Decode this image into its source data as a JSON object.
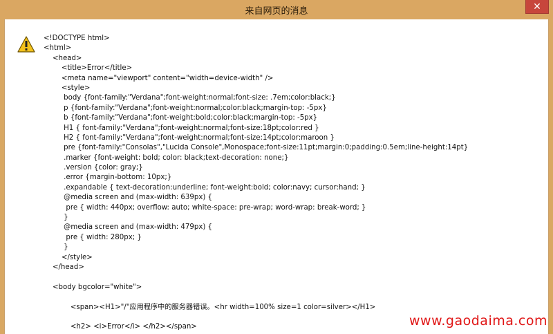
{
  "window": {
    "title": "来自网页的消息",
    "close_glyph": "✕"
  },
  "dialog": {
    "icon": "warning-icon",
    "lines": [
      "<!DOCTYPE html>",
      "<html>",
      "    <head>",
      "        <title>Error</title>",
      "        <meta name=\"viewport\" content=\"width=device-width\" />",
      "        <style>",
      "         body {font-family:\"Verdana\";font-weight:normal;font-size: .7em;color:black;}",
      "         p {font-family:\"Verdana\";font-weight:normal;color:black;margin-top: -5px}",
      "         b {font-family:\"Verdana\";font-weight:bold;color:black;margin-top: -5px}",
      "         H1 { font-family:\"Verdana\";font-weight:normal;font-size:18pt;color:red }",
      "         H2 { font-family:\"Verdana\";font-weight:normal;font-size:14pt;color:maroon }",
      "         pre {font-family:\"Consolas\",\"Lucida Console\",Monospace;font-size:11pt;margin:0;padding:0.5em;line-height:14pt}",
      "         .marker {font-weight: bold; color: black;text-decoration: none;}",
      "         .version {color: gray;}",
      "         .error {margin-bottom: 10px;}",
      "         .expandable { text-decoration:underline; font-weight:bold; color:navy; cursor:hand; }",
      "         @media screen and (max-width: 639px) {",
      "          pre { width: 440px; overflow: auto; white-space: pre-wrap; word-wrap: break-word; }",
      "         }",
      "         @media screen and (max-width: 479px) {",
      "          pre { width: 280px; }",
      "         }",
      "        </style>",
      "    </head>",
      "",
      "    <body bgcolor=\"white\">",
      "",
      "            <span><H1>\"/\"应用程序中的服务器错误。<hr width=100% size=1 color=silver></H1>",
      "",
      "            <h2> <i>Error</i> </h2></span>"
    ]
  },
  "watermark": "www.gaodaima.com"
}
